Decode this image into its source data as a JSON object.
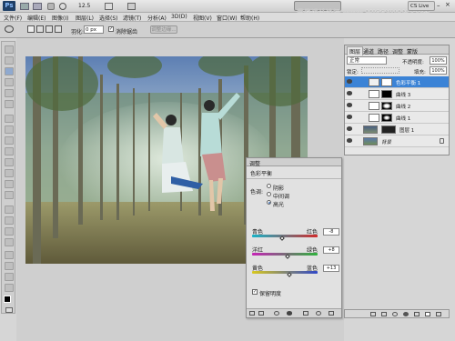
{
  "app": {
    "logo": "Ps",
    "zoom": "12.5",
    "cslive": "CS Live"
  },
  "menu": [
    "文件(F)",
    "编辑(E)",
    "图像(I)",
    "图层(L)",
    "选择(S)",
    "滤镜(T)",
    "分析(A)",
    "3D(D)",
    "视图(V)",
    "窗口(W)",
    "帮助(H)"
  ],
  "watermark": "思缘设计论坛 www.MISSYUAN.COM",
  "options": {
    "feather_label": "羽化:",
    "feather_value": "0 px",
    "antialias_label": "消除锯齿",
    "refine_button": "调整边缘..."
  },
  "layers_panel": {
    "tabs": [
      "图层",
      "通道",
      "路径",
      "调整",
      "蒙版"
    ],
    "blend_mode": "正常",
    "opacity_label": "不透明度:",
    "opacity_value": "100%",
    "lock_label": "锁定:",
    "fill_label": "填充:",
    "fill_value": "100%",
    "layers": [
      {
        "name": "色彩平衡 1",
        "selected": true
      },
      {
        "name": "曲线 3"
      },
      {
        "name": "曲线 2"
      },
      {
        "name": "曲线 1"
      },
      {
        "name": "图层 1"
      },
      {
        "name": "背景"
      }
    ]
  },
  "adjust_panel": {
    "title": "调整",
    "subtitle": "色彩平衡",
    "tone_label": "色调:",
    "tones": [
      "阴影",
      "中间调",
      "高光"
    ],
    "selected_tone": 2,
    "sliders": [
      {
        "left": "青色",
        "right": "红色",
        "value": "-8",
        "level": -8
      },
      {
        "left": "洋红",
        "right": "绿色",
        "value": "+8",
        "level": 8
      },
      {
        "left": "黄色",
        "right": "蓝色",
        "value": "+13",
        "level": 13
      }
    ],
    "preserve_label": "保留明度"
  },
  "colors": {
    "accent": "#3f7fc8",
    "selected_row": "#3b83d6"
  }
}
